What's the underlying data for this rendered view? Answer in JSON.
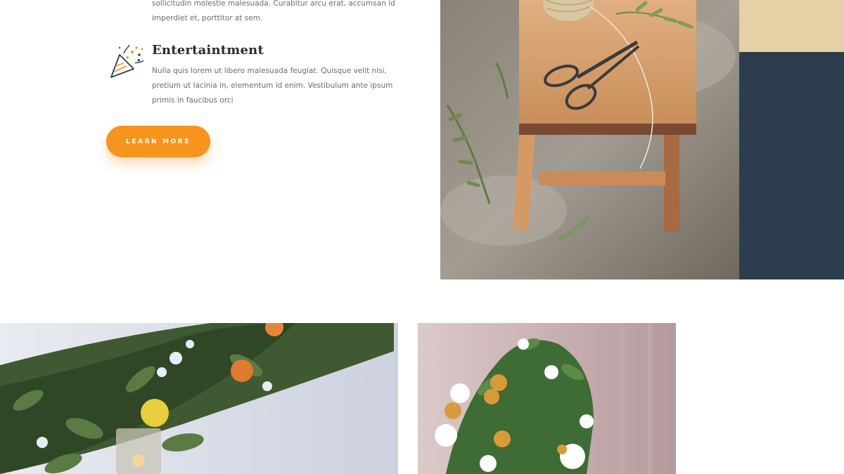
{
  "previous_item": {
    "text": "sollicitudin molestie malesuada. Curabitur arcu erat, accumsan id imperdiet et, porttitor at sem."
  },
  "feature": {
    "icon": "party-popper-icon",
    "title": "Entertaintment",
    "description": "Nulla quis lorem ut libero malesuada feugiat. Quisque velit nisi, pretium ut lacinia in, elementum id enim. Vestibulum ante ipsum primis in faucibus orci"
  },
  "cta": {
    "label": "LEARN MORE"
  },
  "colors": {
    "accent": "#f7941d",
    "beige": "#e6d0a5",
    "navy": "#2c3e4e",
    "body_text": "#6b6b6b",
    "heading": "#2b2b2b"
  },
  "images": {
    "stool": "wooden-stool-scissors-twine-photo",
    "garland": "greenery-garland-lemons-candle-photo",
    "bouquet": "daisy-bouquet-photo"
  }
}
